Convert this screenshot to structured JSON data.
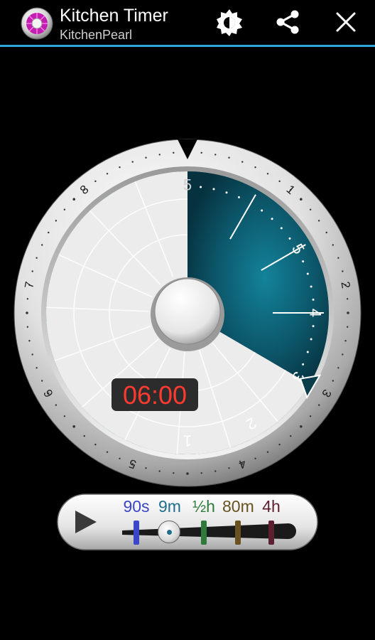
{
  "header": {
    "title": "Kitchen Timer",
    "subtitle": "KitchenPearl",
    "accent_color": "#2ea7d8",
    "icons": [
      "app-icon",
      "brightness-icon",
      "share-icon",
      "close-icon"
    ]
  },
  "dial": {
    "outer_labels": [
      "1",
      "2",
      "3",
      "4",
      "5",
      "6",
      "7",
      "8"
    ],
    "inner_labels": [
      "5",
      "4",
      "3",
      "2",
      "1",
      "5"
    ],
    "elapsed_fraction": 0.666,
    "face_color": "#0c5568",
    "display_time": "06:00",
    "display_color": "#ff3b30"
  },
  "presets": {
    "play_icon": "play-icon",
    "items": [
      {
        "label": "90s",
        "color": "#3b45c8"
      },
      {
        "label": "9m",
        "color": "#1f6e8e"
      },
      {
        "label": "½h",
        "color": "#2e7a3a"
      },
      {
        "label": "80m",
        "color": "#6a5120"
      },
      {
        "label": "4h",
        "color": "#5e2030"
      }
    ],
    "selected_index": 1
  }
}
